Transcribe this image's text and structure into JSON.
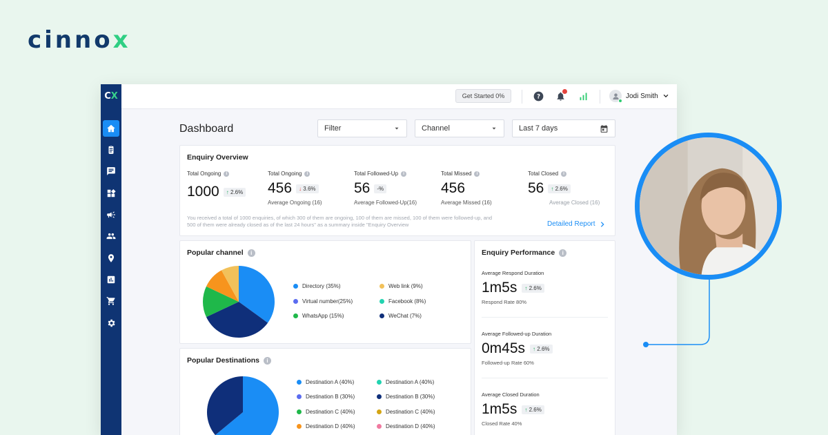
{
  "brand": {
    "name_main": "cinno",
    "name_accent": "x"
  },
  "sidebar": {
    "logo_main": "C",
    "logo_accent": "X",
    "items": [
      {
        "icon": "home-icon",
        "active": true
      },
      {
        "icon": "clipboard-icon"
      },
      {
        "icon": "chat-icon"
      },
      {
        "icon": "widgets-icon"
      },
      {
        "icon": "megaphone-icon"
      },
      {
        "icon": "people-icon"
      },
      {
        "icon": "location-pin-icon"
      },
      {
        "icon": "bar-chart-icon"
      },
      {
        "icon": "cart-icon"
      },
      {
        "icon": "settings-gear-icon"
      }
    ]
  },
  "topbar": {
    "get_started": "Get Started 0%",
    "user_name": "Jodi Smith"
  },
  "page": {
    "title": "Dashboard",
    "filter": "Filter",
    "channel": "Channel",
    "date_range": "Last 7 days"
  },
  "overview": {
    "title": "Enquiry Overview",
    "metrics": [
      {
        "label": "Total Ongoing",
        "value": "1000",
        "change": "2.6%",
        "direction": "up",
        "sub": ""
      },
      {
        "label": "Total Ongoing",
        "value": "456",
        "change": "3.6%",
        "direction": "down",
        "sub": "Average Ongoing (16)"
      },
      {
        "label": "Total Followed-Up",
        "value": "56",
        "change": "-%",
        "direction": "none",
        "sub": "Average Followed-Up(16)"
      },
      {
        "label": "Total Missed",
        "value": "456",
        "change": "",
        "direction": "none",
        "sub": "Average Missed (16)"
      },
      {
        "label": "Total Closed",
        "value": "56",
        "change": "2.6%",
        "direction": "up",
        "sub": "Average Closed (16)"
      }
    ],
    "note": "You received a total of 1000 enquiries, of which 300 of them are ongoing, 100 of them are missed, 100 of them were followed-up, and 500 of them were already closed as of the last 24 hours\" as a summary inside \"Enquiry Overview",
    "detail_link": "Detailed Report"
  },
  "popular_channel": {
    "title": "Popular channel",
    "chart_data": {
      "type": "pie",
      "labels": [
        "Directory",
        "Virtual number",
        "WhatsApp",
        "Web link",
        "Facebook",
        "WeChat"
      ],
      "values": [
        35,
        25,
        15,
        9,
        8,
        7
      ],
      "legend": [
        {
          "label": "Directory (35%)",
          "color": "#1a8df5"
        },
        {
          "label": "Web link (9%)",
          "color": "#f2c15a"
        },
        {
          "label": "Virtual number(25%)",
          "color": "#5b6cf0"
        },
        {
          "label": "Facebook (8%)",
          "color": "#22d3b0"
        },
        {
          "label": "WhatsApp (15%)",
          "color": "#1fb84a"
        },
        {
          "label": "WeChat (7%)",
          "color": "#0f2f7a"
        }
      ],
      "slices": [
        {
          "value": 35,
          "color": "#1a8df5"
        },
        {
          "value": 33,
          "color": "#0f2f7a"
        },
        {
          "value": 14,
          "color": "#1fb84a"
        },
        {
          "value": 10,
          "color": "#f7941d"
        },
        {
          "value": 8,
          "color": "#f2c15a"
        }
      ]
    }
  },
  "popular_destinations": {
    "title": "Popular Destinations",
    "chart_data": {
      "type": "pie",
      "legend": [
        {
          "label": "Destination A (40%)",
          "color": "#1a8df5"
        },
        {
          "label": "Destination A (40%)",
          "color": "#22d3b0"
        },
        {
          "label": "Destination B (30%)",
          "color": "#5b6cf0"
        },
        {
          "label": "Destination B (30%)",
          "color": "#0f2f7a"
        },
        {
          "label": "Destination C (40%)",
          "color": "#1fb84a"
        },
        {
          "label": "Destination C (40%)",
          "color": "#d4a514"
        },
        {
          "label": "Destination D (40%)",
          "color": "#f7941d"
        },
        {
          "label": "Destination D (40%)",
          "color": "#f07aa0"
        }
      ],
      "slices": [
        {
          "value": 64,
          "color": "#1a8df5"
        },
        {
          "value": 36,
          "color": "#0f2f7a"
        }
      ]
    }
  },
  "performance": {
    "title": "Enquiry Performance",
    "items": [
      {
        "label": "Average Respond Duration",
        "value": "1m5s",
        "change": "2.6%",
        "sub": "Respond Rate 80%"
      },
      {
        "label": "Average Followed-up Duration",
        "value": "0m45s",
        "change": "2.6%",
        "sub": "Followed-up Rate 60%"
      },
      {
        "label": "Average Closed Duration",
        "value": "1m5s",
        "change": "2.6%",
        "sub": "Closed Rate 40%"
      }
    ]
  },
  "colors": {
    "accent": "#1a8df5",
    "sidebar": "#0f3473",
    "background": "#e9f6ee",
    "brand_green": "#2fcf83"
  }
}
